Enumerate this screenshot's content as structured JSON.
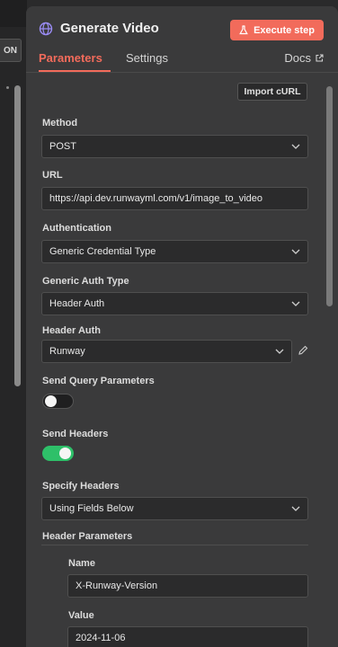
{
  "backdrop": {
    "chip_label": "ON"
  },
  "header": {
    "title": "Generate Video",
    "execute_label": "Execute step",
    "tabs": [
      {
        "label": "Parameters",
        "active": true
      },
      {
        "label": "Settings",
        "active": false
      }
    ],
    "docs_label": "Docs"
  },
  "form": {
    "import_label": "Import cURL",
    "method": {
      "label": "Method",
      "value": "POST"
    },
    "url": {
      "label": "URL",
      "value": "https://api.dev.runwayml.com/v1/image_to_video"
    },
    "authentication": {
      "label": "Authentication",
      "value": "Generic Credential Type"
    },
    "generic_auth_type": {
      "label": "Generic Auth Type",
      "value": "Header Auth"
    },
    "header_auth": {
      "label": "Header Auth",
      "value": "Runway"
    },
    "send_query": {
      "label": "Send Query Parameters",
      "enabled": false
    },
    "send_headers": {
      "label": "Send Headers",
      "enabled": true
    },
    "specify_headers": {
      "label": "Specify Headers",
      "value": "Using Fields Below"
    },
    "header_parameters": {
      "label": "Header Parameters",
      "name_label": "Name",
      "name_value": "X-Runway-Version",
      "value_label": "Value",
      "value_value": "2024-11-06"
    }
  },
  "colors": {
    "accent": "#f26b5b",
    "toggle_on": "#2ec069",
    "panel": "#3a3a3b"
  }
}
